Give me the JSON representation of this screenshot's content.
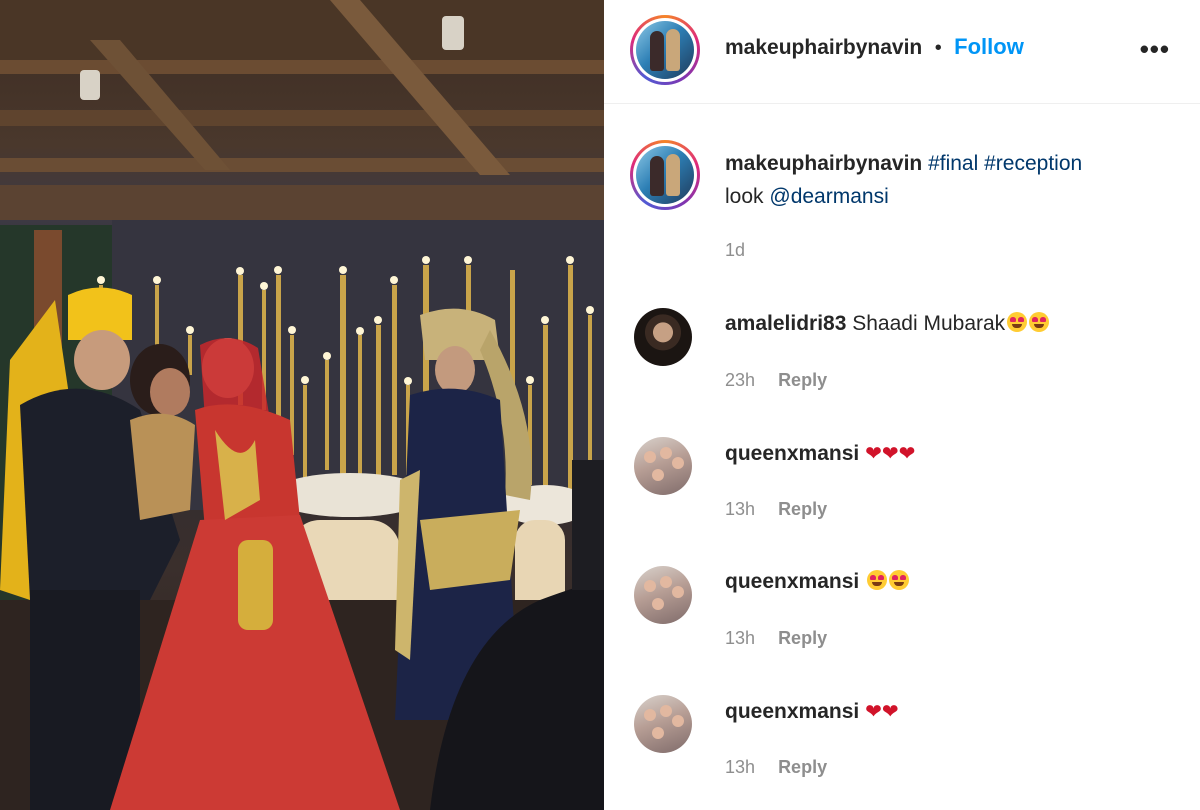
{
  "post": {
    "photo": {
      "alt_icon": "wedding-reception-photo",
      "palette": {
        "bride_dress": "#c8362f",
        "groom_sherwani": "#1c2447",
        "turban": "#f2c21a",
        "candle_gold": "#c9a44a"
      }
    }
  },
  "header": {
    "username": "makeuphairbynavin",
    "separator": "•",
    "follow_label": "Follow",
    "more_icon": "more-horizontal-icon",
    "more_label": "•••"
  },
  "caption": {
    "username": "makeuphairbynavin",
    "hashtags": [
      "#final",
      "#reception"
    ],
    "text_after": "look",
    "mention": "@dearmansi",
    "time": "1d"
  },
  "comments": [
    {
      "username": "amalelidri83",
      "text": "Shaadi Mubarak",
      "emoji": "heart-eyes-face x2",
      "time": "23h",
      "reply_label": "Reply"
    },
    {
      "username": "queenxmansi",
      "text": "",
      "emoji": "red-heart x3",
      "hearts": "❤❤❤",
      "time": "13h",
      "reply_label": "Reply"
    },
    {
      "username": "queenxmansi",
      "text": "",
      "emoji": "heart-eyes-face x2",
      "time": "13h",
      "reply_label": "Reply"
    },
    {
      "username": "queenxmansi",
      "text": "",
      "emoji": "red-heart x2",
      "hearts": "❤❤",
      "time": "13h",
      "reply_label": "Reply"
    }
  ],
  "colors": {
    "link_blue": "#0095f6",
    "hashtag_navy": "#00376b",
    "meta_gray": "#8e8e8e",
    "text": "#262626"
  }
}
